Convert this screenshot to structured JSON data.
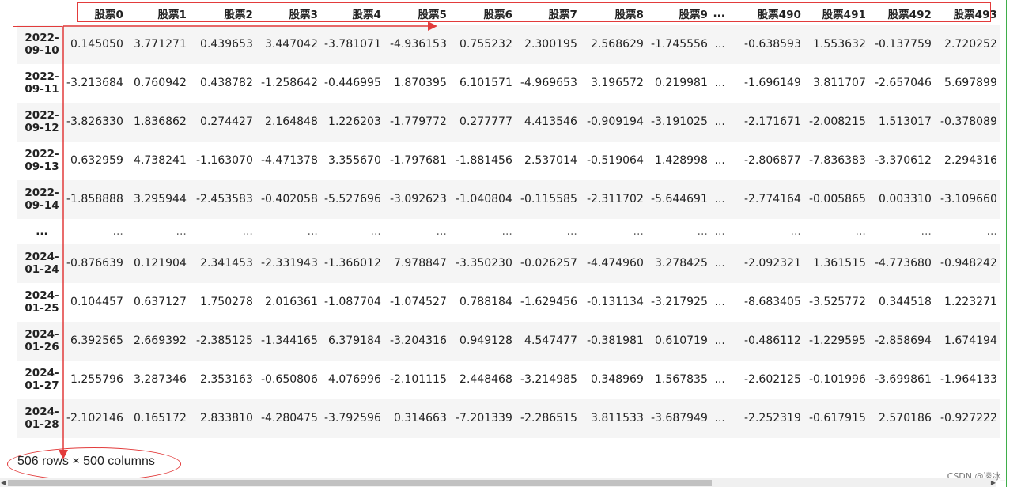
{
  "columns": [
    "股票0",
    "股票1",
    "股票2",
    "股票3",
    "股票4",
    "股票5",
    "股票6",
    "股票7",
    "股票8",
    "股票9",
    "...",
    "股票490",
    "股票491",
    "股票492",
    "股票493"
  ],
  "rows": [
    {
      "index": [
        "2022-",
        "09-10"
      ],
      "values": [
        "0.145050",
        "3.771271",
        "0.439653",
        "3.447042",
        "-3.781071",
        "-4.936153",
        "0.755232",
        "2.300195",
        "2.568629",
        "-1.745556",
        "...",
        "-0.638593",
        "1.553632",
        "-0.137759",
        "2.720252"
      ]
    },
    {
      "index": [
        "2022-",
        "09-11"
      ],
      "values": [
        "-3.213684",
        "0.760942",
        "0.438782",
        "-1.258642",
        "-0.446995",
        "1.870395",
        "6.101571",
        "-4.969653",
        "3.196572",
        "0.219981",
        "...",
        "-1.696149",
        "3.811707",
        "-2.657046",
        "5.697899"
      ]
    },
    {
      "index": [
        "2022-",
        "09-12"
      ],
      "values": [
        "-3.826330",
        "1.836862",
        "0.274427",
        "2.164848",
        "1.226203",
        "-1.779772",
        "0.277777",
        "4.413546",
        "-0.909194",
        "-3.191025",
        "...",
        "-2.171671",
        "-2.008215",
        "1.513017",
        "-0.378089"
      ]
    },
    {
      "index": [
        "2022-",
        "09-13"
      ],
      "values": [
        "0.632959",
        "4.738241",
        "-1.163070",
        "-4.471378",
        "3.355670",
        "-1.797681",
        "-1.881456",
        "2.537014",
        "-0.519064",
        "1.428998",
        "...",
        "-2.806877",
        "-7.836383",
        "-3.370612",
        "2.294316"
      ]
    },
    {
      "index": [
        "2022-",
        "09-14"
      ],
      "values": [
        "-1.858888",
        "3.295944",
        "-2.453583",
        "-0.402058",
        "-5.527696",
        "-3.092623",
        "-1.040804",
        "-0.115585",
        "-2.311702",
        "-5.644691",
        "...",
        "-2.774164",
        "-0.005865",
        "0.003310",
        "-3.109660"
      ]
    },
    {
      "index": [
        "..."
      ],
      "values": [
        "...",
        "...",
        "...",
        "...",
        "...",
        "...",
        "...",
        "...",
        "...",
        "...",
        "...",
        "...",
        "...",
        "...",
        "..."
      ],
      "ellipsis": true
    },
    {
      "index": [
        "2024-",
        "01-24"
      ],
      "values": [
        "-0.876639",
        "0.121904",
        "2.341453",
        "-2.331943",
        "-1.366012",
        "7.978847",
        "-3.350230",
        "-0.026257",
        "-4.474960",
        "3.278425",
        "...",
        "-2.092321",
        "1.361515",
        "-4.773680",
        "-0.948242"
      ]
    },
    {
      "index": [
        "2024-",
        "01-25"
      ],
      "values": [
        "0.104457",
        "0.637127",
        "1.750278",
        "2.016361",
        "-1.087704",
        "-1.074527",
        "0.788184",
        "-1.629456",
        "-0.131134",
        "-3.217925",
        "...",
        "-8.683405",
        "-3.525772",
        "0.344518",
        "1.223271"
      ]
    },
    {
      "index": [
        "2024-",
        "01-26"
      ],
      "values": [
        "6.392565",
        "2.669392",
        "-2.385125",
        "-1.344165",
        "6.379184",
        "-3.204316",
        "0.949128",
        "4.547477",
        "-0.381981",
        "0.610719",
        "...",
        "-0.486112",
        "-1.229595",
        "-2.858694",
        "1.674194"
      ]
    },
    {
      "index": [
        "2024-",
        "01-27"
      ],
      "values": [
        "1.255796",
        "3.287346",
        "2.353163",
        "-0.650806",
        "4.076996",
        "-2.101115",
        "2.448468",
        "-3.214985",
        "0.348969",
        "1.567835",
        "...",
        "-2.602125",
        "-0.101996",
        "-3.699861",
        "-1.964133"
      ]
    },
    {
      "index": [
        "2024-",
        "01-28"
      ],
      "values": [
        "-2.102146",
        "0.165172",
        "2.833810",
        "-4.280475",
        "-3.792596",
        "0.314663",
        "-7.201339",
        "-2.286515",
        "3.811533",
        "-3.687949",
        "...",
        "-2.252319",
        "-0.617915",
        "2.570186",
        "-0.927222"
      ]
    }
  ],
  "shape_text": "506 rows × 500 columns",
  "watermark": "CSDN @凌冰_",
  "colors": {
    "annotation": "#e23b3b",
    "stripe": "#f5f5f5",
    "frame": "#3fae4a"
  }
}
